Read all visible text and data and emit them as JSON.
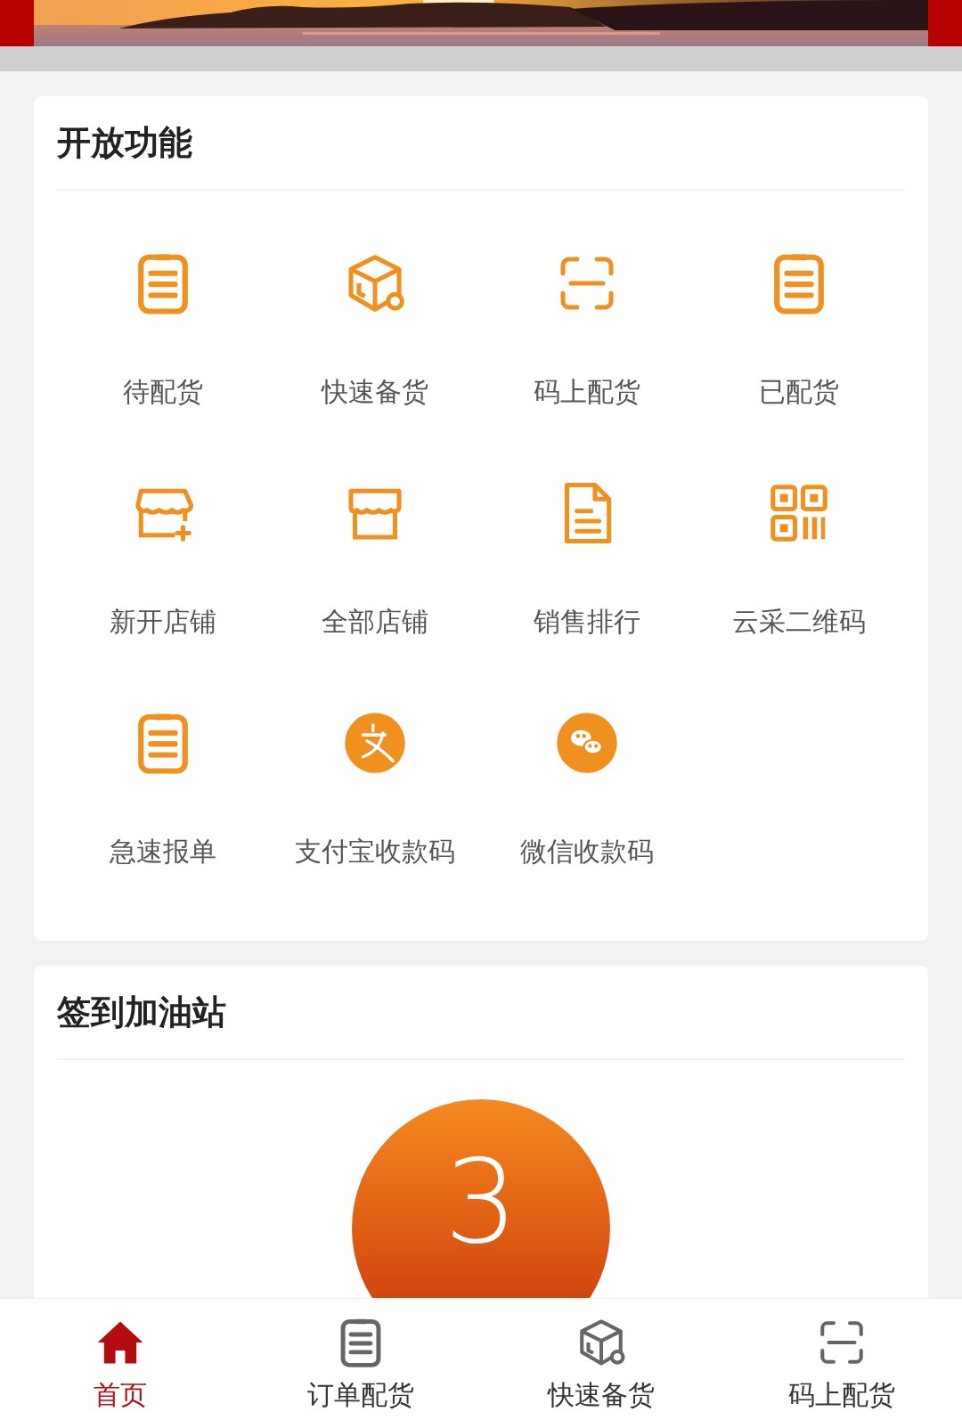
{
  "features": {
    "title": "开放功能",
    "items": [
      {
        "label": "待配货",
        "kind": "clipboard"
      },
      {
        "label": "快速备货",
        "kind": "box"
      },
      {
        "label": "码上配货",
        "kind": "scan"
      },
      {
        "label": "已配货",
        "kind": "clipboard"
      },
      {
        "label": "新开店铺",
        "kind": "store-plus"
      },
      {
        "label": "全部店铺",
        "kind": "store"
      },
      {
        "label": "销售排行",
        "kind": "document"
      },
      {
        "label": "云采二维码",
        "kind": "qr"
      },
      {
        "label": "急速报单",
        "kind": "clipboard"
      },
      {
        "label": "支付宝收款码",
        "kind": "alipay"
      },
      {
        "label": "微信收款码",
        "kind": "wechat"
      }
    ]
  },
  "checkin": {
    "title": "签到加油站",
    "count": "3"
  },
  "bottom_nav": [
    {
      "label": "首页",
      "kind": "home",
      "selected": true
    },
    {
      "label": "订单配货",
      "kind": "clipboard",
      "selected": false
    },
    {
      "label": "快速备货",
      "kind": "box",
      "selected": false
    },
    {
      "label": "码上配货",
      "kind": "scan",
      "selected": false
    }
  ]
}
